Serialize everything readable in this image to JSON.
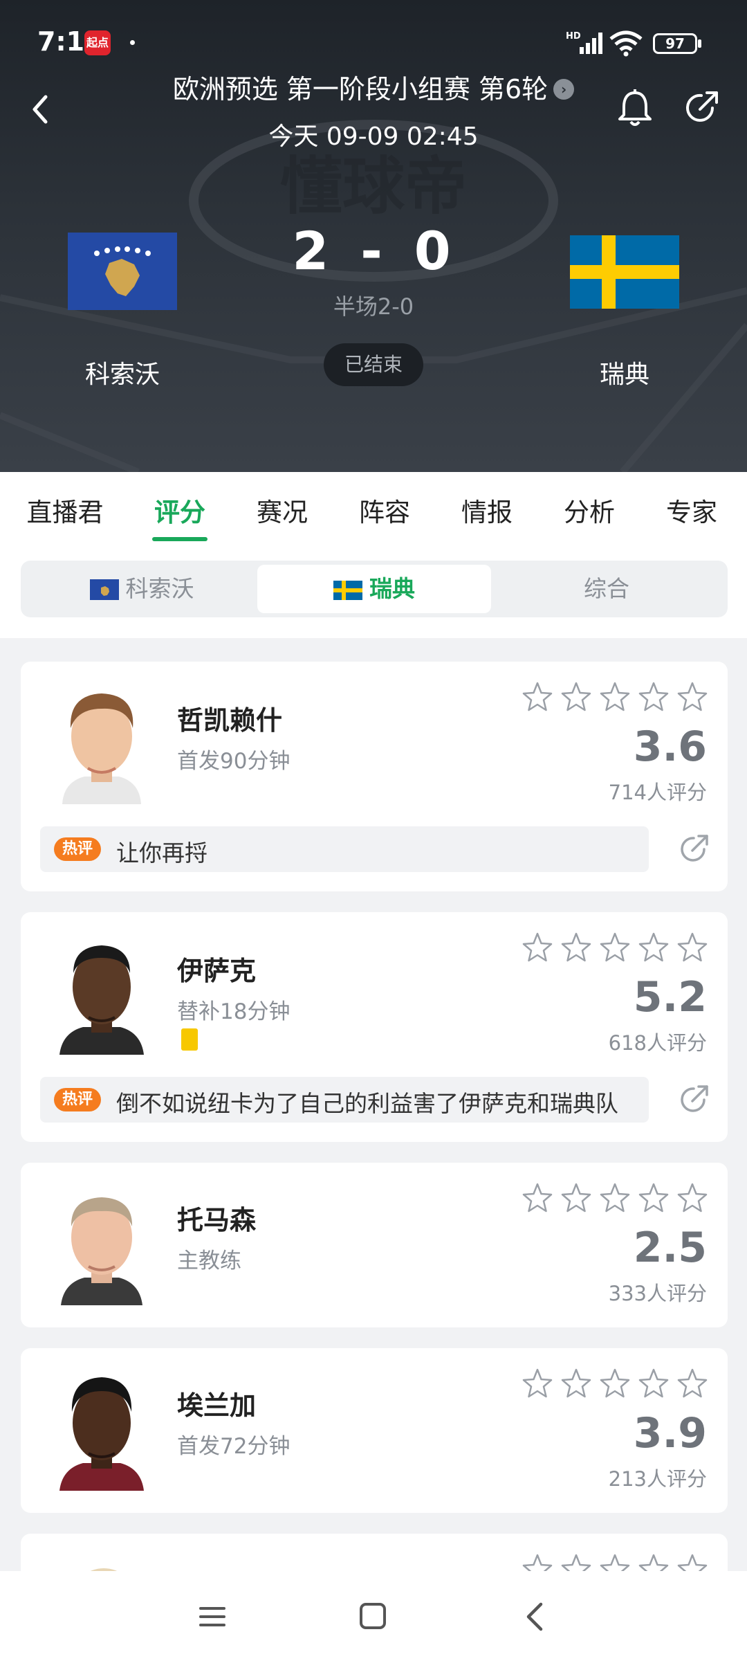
{
  "status_bar": {
    "time": "7:11",
    "app_badge": "起点",
    "network": "HD",
    "battery": "97"
  },
  "header": {
    "competition": "欧洲预选 第一阶段小组赛 第6轮",
    "time": "今天 09-09 02:45",
    "home_team": "科索沃",
    "away_team": "瑞典",
    "home_score": "2",
    "away_score": "0",
    "separator": "-",
    "halftime": "半场2-0",
    "status": "已结束"
  },
  "tabs": [
    {
      "label": "直播君"
    },
    {
      "label": "评分"
    },
    {
      "label": "赛况"
    },
    {
      "label": "阵容"
    },
    {
      "label": "情报"
    },
    {
      "label": "分析"
    },
    {
      "label": "专家"
    }
  ],
  "active_tab": "评分",
  "segments": [
    {
      "label": "科索沃"
    },
    {
      "label": "瑞典"
    },
    {
      "label": "综合"
    }
  ],
  "active_segment": "瑞典",
  "players": [
    {
      "name": "哲凯赖什",
      "subtitle": "首发90分钟",
      "rating": "3.6",
      "raters": "714人评分",
      "hot_tag": "热评",
      "comment": "让你再捋"
    },
    {
      "name": "伊萨克",
      "subtitle": "替补18分钟",
      "rating": "5.2",
      "raters": "618人评分",
      "yellow_cards": 1,
      "hot_tag": "热评",
      "comment": "倒不如说纽卡为了自己的利益害了伊萨克和瑞典队"
    },
    {
      "name": "托马森",
      "subtitle": "主教练",
      "rating": "2.5",
      "raters": "333人评分"
    },
    {
      "name": "埃兰加",
      "subtitle": "首发72分钟",
      "rating": "3.9",
      "raters": "213人评分"
    }
  ],
  "colors": {
    "accent": "#19a85a",
    "hot_tag": "#f57c1f",
    "yellow_card": "#f7c800",
    "header_bg": "#2c3239",
    "kosovo_blue": "#244aa5",
    "sweden_blue": "#006aa7",
    "sweden_yellow": "#fecc02"
  },
  "icons": [
    "back-arrow-icon",
    "bell-icon",
    "share-icon",
    "star-outline-icon",
    "menu-icon",
    "home-square-icon",
    "nav-back-icon"
  ]
}
